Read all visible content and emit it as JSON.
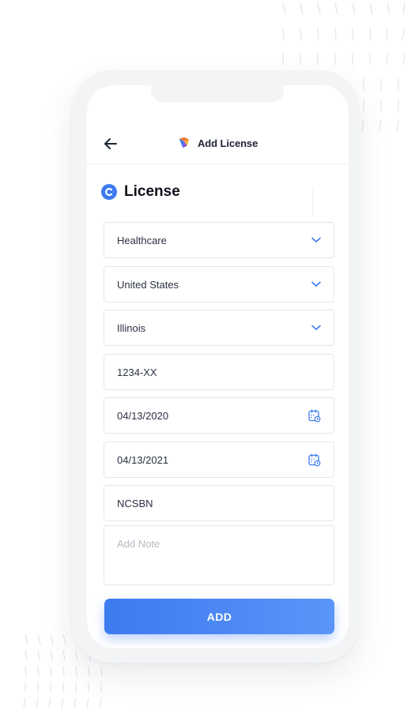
{
  "header": {
    "title": "Add License",
    "back_icon": "arrow-left-icon",
    "logo_icon": "app-logo-icon"
  },
  "section": {
    "title": "License",
    "icon": "license-c-icon"
  },
  "form": {
    "industry": "Healthcare",
    "country": "United States",
    "state": "Illinois",
    "license_number": "1234-XX",
    "issue_date": "04/13/2020",
    "expiry_date": "04/13/2021",
    "issuer": "NCSBN",
    "note_placeholder": "Add Note"
  },
  "actions": {
    "add_label": "ADD"
  },
  "colors": {
    "accent": "#3c7bf0",
    "text": "#1d2433",
    "placeholder": "#b4b9c3"
  }
}
